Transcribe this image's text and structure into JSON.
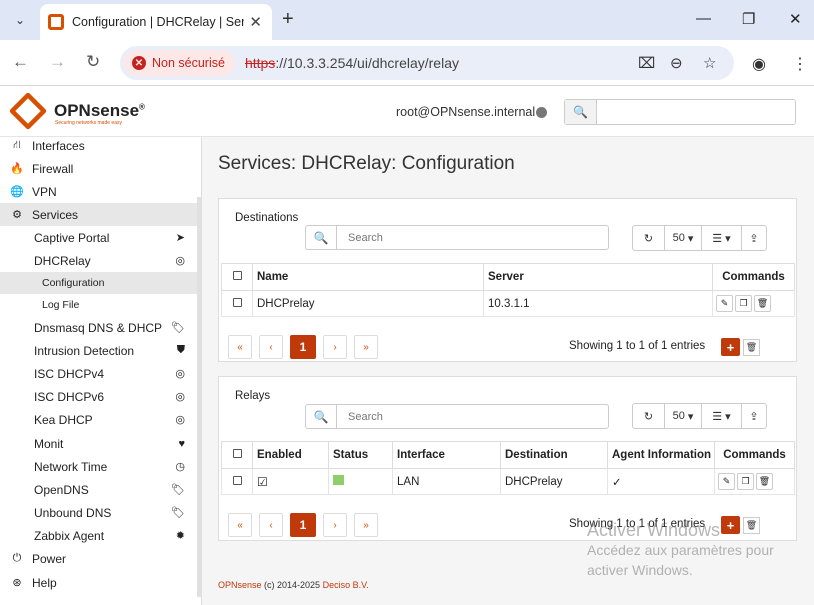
{
  "browser": {
    "tab_title": "Configuration | DHCRelay | Serv",
    "security_label": "Non sécurisé",
    "url_scheme": "https",
    "url_rest": "://10.3.3.254/ui/dhcrelay/relay"
  },
  "header": {
    "logo_text": "OPNsense",
    "logo_tagline": "Securing networks made easy",
    "user": "root@OPNsense.internal"
  },
  "sidebar": {
    "items": [
      {
        "label": "Interfaces",
        "icon": "sitemap-icon"
      },
      {
        "label": "Firewall",
        "icon": "fire-icon"
      },
      {
        "label": "VPN",
        "icon": "globe-icon"
      },
      {
        "label": "Services",
        "icon": "cogs-icon"
      },
      {
        "label": "Power",
        "icon": "plug-icon"
      },
      {
        "label": "Help",
        "icon": "lifebuoy-icon"
      }
    ],
    "services": [
      {
        "label": "Captive Portal",
        "icon": "send-icon",
        "glyph": "➤"
      },
      {
        "label": "DHCRelay",
        "icon": "bullseye-icon",
        "glyph": "◎"
      },
      {
        "label": "Dnsmasq DNS & DHCP",
        "icon": "tags-icon",
        "glyph": "🏷"
      },
      {
        "label": "Intrusion Detection",
        "icon": "shield-icon",
        "glyph": "⛊"
      },
      {
        "label": "ISC DHCPv4",
        "icon": "bullseye-icon",
        "glyph": "◎"
      },
      {
        "label": "ISC DHCPv6",
        "icon": "bullseye-icon",
        "glyph": "◎"
      },
      {
        "label": "Kea DHCP",
        "icon": "bullseye-icon",
        "glyph": "◎"
      },
      {
        "label": "Monit",
        "icon": "heartbeat-icon",
        "glyph": "♥"
      },
      {
        "label": "Network Time",
        "icon": "clock-icon",
        "glyph": "◷"
      },
      {
        "label": "OpenDNS",
        "icon": "tags-icon",
        "glyph": "🏷"
      },
      {
        "label": "Unbound DNS",
        "icon": "tags-icon",
        "glyph": "🏷"
      },
      {
        "label": "Zabbix Agent",
        "icon": "gear-icon",
        "glyph": "✹"
      }
    ],
    "dhcrelay_sub": [
      "Configuration",
      "Log File"
    ]
  },
  "main": {
    "title": "Services: DHCRelay: Configuration",
    "destinations": {
      "label": "Destinations",
      "search_placeholder": "Search",
      "page_size": "50",
      "columns": [
        "Name",
        "Server",
        "Commands"
      ],
      "rows": [
        {
          "name": "DHCPrelay",
          "server": "10.3.1.1"
        }
      ],
      "showing": "Showing 1 to 1 of 1 entries"
    },
    "relays": {
      "label": "Relays",
      "search_placeholder": "Search",
      "page_size": "50",
      "columns": [
        "Enabled",
        "Status",
        "Interface",
        "Destination",
        "Agent Information",
        "Commands"
      ],
      "rows": [
        {
          "interface": "LAN",
          "destination": "DHCPrelay"
        }
      ],
      "showing": "Showing 1 to 1 of 1 entries"
    },
    "pager": {
      "first": "«",
      "prev": "‹",
      "page": "1",
      "next": "›",
      "last": "»"
    },
    "footer": {
      "brand": "OPNsense",
      "copyright": " (c) 2014-2025 ",
      "company": "Deciso B.V."
    }
  },
  "watermark": {
    "line1": "Activer Windows",
    "line2": "Accédez aux paramètres pour",
    "line3": "activer Windows."
  }
}
